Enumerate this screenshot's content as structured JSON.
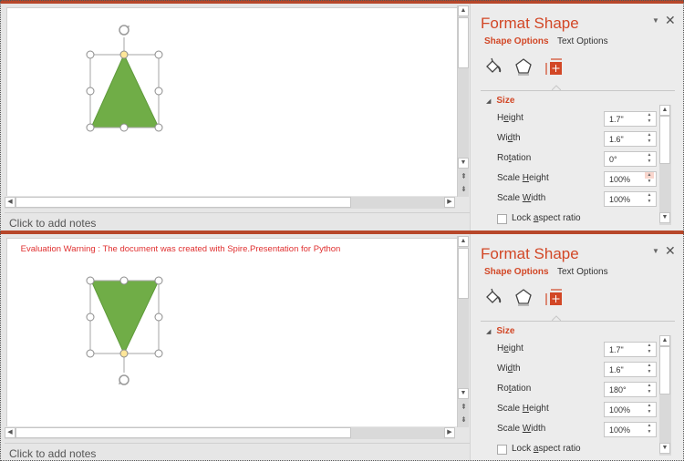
{
  "panes": [
    {
      "id": "top",
      "warning": null,
      "shape": {
        "type": "isosceles-triangle",
        "fill": "#70ad47",
        "rotation_deg": 0
      },
      "notes_placeholder": "Click to add notes",
      "format_panel": {
        "title": "Format Shape",
        "tabs": [
          {
            "label": "Shape Options",
            "active": true
          },
          {
            "label": "Text Options",
            "active": false
          }
        ],
        "icons": [
          "fill-line-icon",
          "effects-icon",
          "size-properties-icon"
        ],
        "section": "Size",
        "properties": [
          {
            "pre": "H",
            "ul": "e",
            "post": "ight",
            "value": "1.7\""
          },
          {
            "pre": "Wi",
            "ul": "d",
            "post": "th",
            "value": "1.6\""
          },
          {
            "pre": "Ro",
            "ul": "t",
            "post": "ation",
            "value": "0°"
          },
          {
            "pre": "Scale ",
            "ul": "H",
            "post": "eight",
            "value": "100%"
          },
          {
            "pre": "Scale ",
            "ul": "W",
            "post": "idth",
            "value": "100%"
          }
        ],
        "lock_aspect": {
          "pre": "Lock ",
          "ul": "a",
          "post": "spect ratio",
          "checked": false
        }
      }
    },
    {
      "id": "bottom",
      "warning": "Evaluation Warning : The document was created with Spire.Presentation for Python",
      "shape": {
        "type": "isosceles-triangle",
        "fill": "#70ad47",
        "rotation_deg": 180
      },
      "notes_placeholder": "Click to add notes",
      "format_panel": {
        "title": "Format Shape",
        "tabs": [
          {
            "label": "Shape Options",
            "active": true
          },
          {
            "label": "Text Options",
            "active": false
          }
        ],
        "icons": [
          "fill-line-icon",
          "effects-icon",
          "size-properties-icon"
        ],
        "section": "Size",
        "properties": [
          {
            "pre": "H",
            "ul": "e",
            "post": "ight",
            "value": "1.7\""
          },
          {
            "pre": "Wi",
            "ul": "d",
            "post": "th",
            "value": "1.6\""
          },
          {
            "pre": "Ro",
            "ul": "t",
            "post": "ation",
            "value": "180°"
          },
          {
            "pre": "Scale ",
            "ul": "H",
            "post": "eight",
            "value": "100%"
          },
          {
            "pre": "Scale ",
            "ul": "W",
            "post": "idth",
            "value": "100%"
          }
        ],
        "lock_aspect": {
          "pre": "Lock ",
          "ul": "a",
          "post": "spect ratio",
          "checked": false
        }
      }
    }
  ],
  "colors": {
    "accent": "#d24726",
    "bar": "#b7472a",
    "shape_fill": "#70ad47",
    "warning": "#e03030"
  }
}
